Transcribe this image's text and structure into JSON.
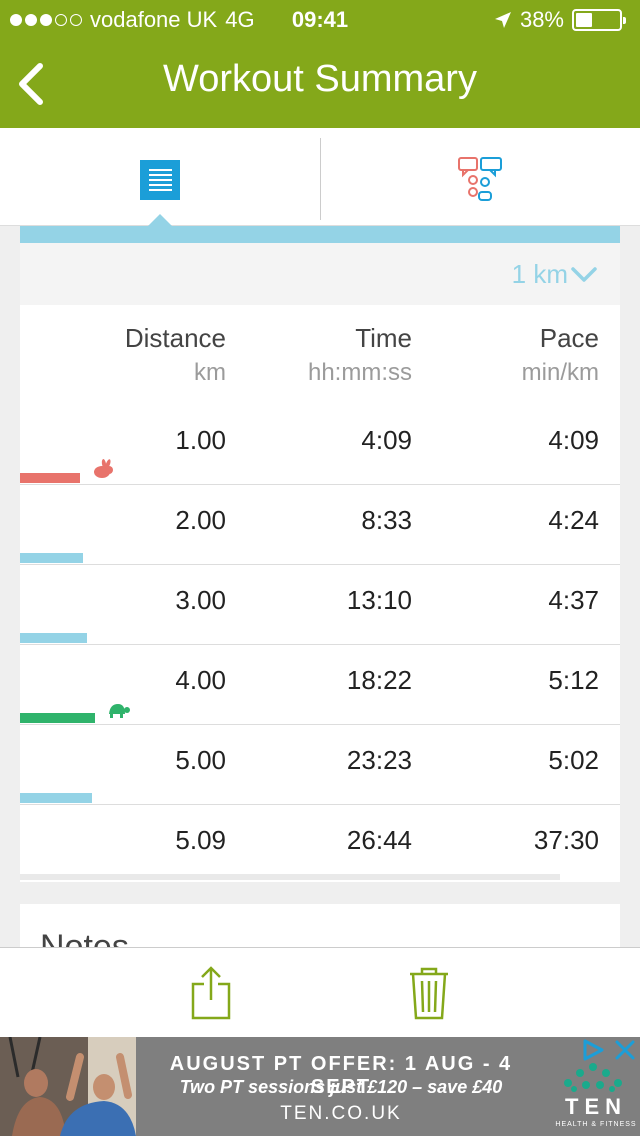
{
  "status_bar": {
    "carrier": "vodafone UK",
    "network": "4G",
    "time": "09:41",
    "battery": "38%",
    "battery_level": 0.38,
    "signal_bars_filled": 3,
    "signal_bars_total": 5
  },
  "nav": {
    "title": "Workout Summary",
    "back_icon": "chevron-left-icon"
  },
  "tabs": [
    {
      "name": "splits",
      "icon": "list-icon",
      "active": true
    },
    {
      "name": "social",
      "icon": "chat-people-icon",
      "active": false
    }
  ],
  "splits": {
    "interval_label": "1 km",
    "columns": [
      {
        "label": "Distance",
        "unit": "km"
      },
      {
        "label": "Time",
        "unit": "hh:mm:ss"
      },
      {
        "label": "Pace",
        "unit": "min/km"
      }
    ],
    "rows": [
      {
        "distance": "1.00",
        "time": "4:09",
        "pace": "4:09",
        "marker": "rabbit-icon",
        "bar_color": "#e8736b",
        "relative_pace": 0.6
      },
      {
        "distance": "2.00",
        "time": "8:33",
        "pace": "4:24",
        "marker": "",
        "bar_color": "#94d3e6",
        "relative_pace": 0.63
      },
      {
        "distance": "3.00",
        "time": "13:10",
        "pace": "4:37",
        "marker": "",
        "bar_color": "#94d3e6",
        "relative_pace": 0.67
      },
      {
        "distance": "4.00",
        "time": "18:22",
        "pace": "5:12",
        "marker": "turtle-icon",
        "bar_color": "#2fb36b",
        "relative_pace": 0.75
      },
      {
        "distance": "5.00",
        "time": "23:23",
        "pace": "5:02",
        "marker": "",
        "bar_color": "#94d3e6",
        "relative_pace": 0.72
      },
      {
        "distance": "5.09",
        "time": "26:44",
        "pace": "37:30",
        "marker": "",
        "bar_color": "",
        "relative_pace": 0
      }
    ]
  },
  "notes": {
    "title": "Notes"
  },
  "toolbar": {
    "share_icon": "share-icon",
    "delete_icon": "trash-icon"
  },
  "ad": {
    "line1": "AUGUST PT OFFER: 1 AUG - 4 SEPT",
    "line2": "Two PT sessions just £120 – save £40",
    "line3": "TEN.CO.UK",
    "brand": "TEN",
    "brand_sub": "HEALTH & FITNESS"
  },
  "colors": {
    "header_green": "#84a81a",
    "accent_blue": "#1b9ed8",
    "light_blue": "#94d3e6",
    "fast_red": "#e8736b",
    "slow_green": "#2fb36b"
  }
}
